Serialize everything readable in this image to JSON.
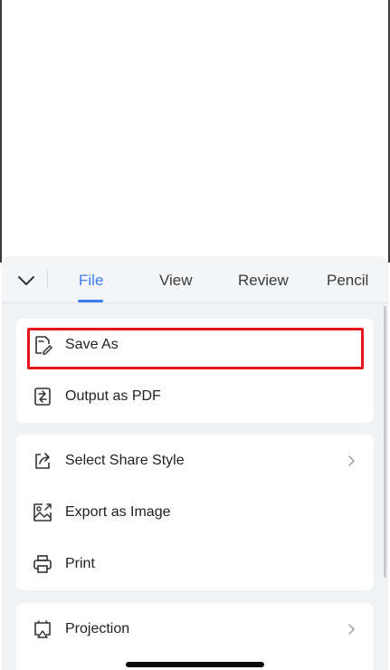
{
  "tabs": [
    {
      "label": "File",
      "active": true
    },
    {
      "label": "View",
      "active": false
    },
    {
      "label": "Review",
      "active": false
    },
    {
      "label": "Pencil",
      "active": false
    }
  ],
  "groups": [
    {
      "items": [
        {
          "label": "Save As",
          "icon": "save-as-icon",
          "has_chevron": false,
          "highlighted": true
        },
        {
          "label": "Output as PDF",
          "icon": "output-pdf-icon",
          "has_chevron": false
        }
      ]
    },
    {
      "items": [
        {
          "label": "Select Share Style",
          "icon": "share-icon",
          "has_chevron": true
        },
        {
          "label": "Export as Image",
          "icon": "image-icon",
          "has_chevron": true
        },
        {
          "label": "Print",
          "icon": "print-icon",
          "has_chevron": false
        }
      ]
    },
    {
      "items": [
        {
          "label": "Projection",
          "icon": "projection-icon",
          "has_chevron": true
        }
      ]
    }
  ],
  "colors": {
    "accent": "#3b7cf0",
    "highlight_box": "#e8141b",
    "sheet_bg": "#f1f2f4"
  }
}
